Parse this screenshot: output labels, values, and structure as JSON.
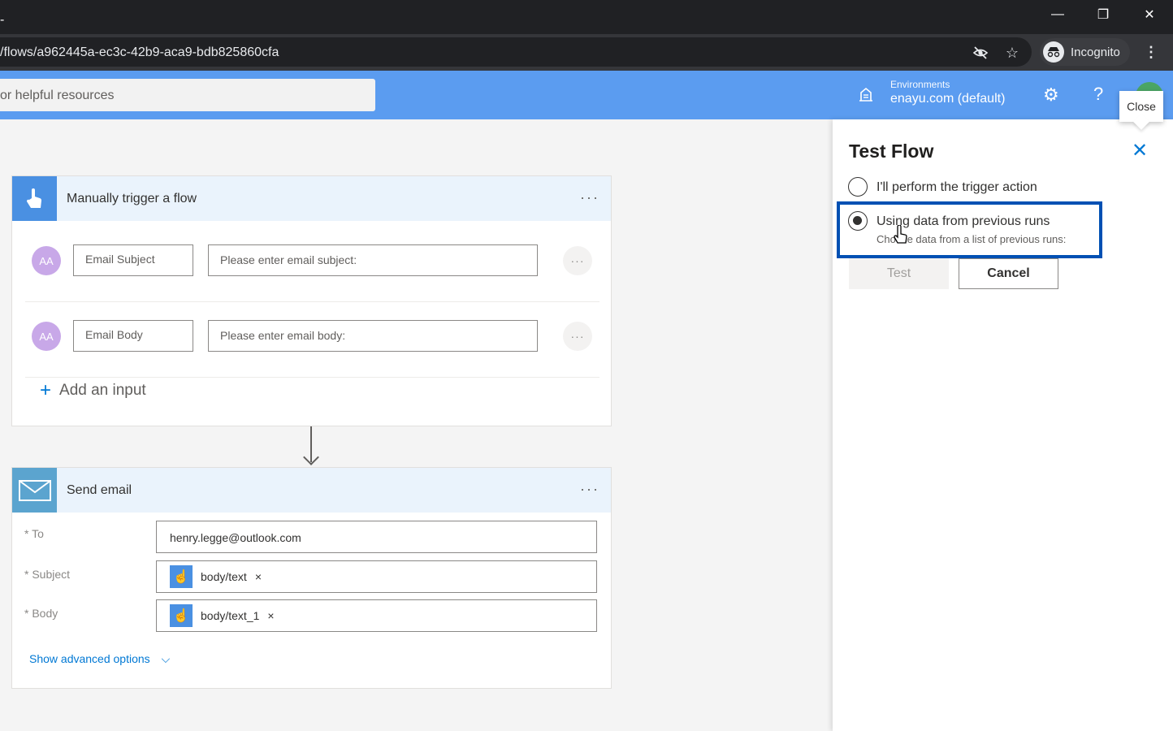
{
  "browser": {
    "url": "/flows/a962445a-ec3c-42b9-aca9-bdb825860cfa",
    "incognito_label": "Incognito",
    "menu_glyph": "⋮"
  },
  "header": {
    "search_placeholder": "or helpful resources",
    "env_label": "Environments",
    "env_value": "enayu.com (default)",
    "help_glyph": "?"
  },
  "tooltip": {
    "text": "Close"
  },
  "trigger_card": {
    "title": "Manually trigger a flow",
    "more": "···",
    "inputs": [
      {
        "avatar": "AA",
        "name": "Email Subject",
        "placeholder": "Please enter email subject:",
        "more": "···"
      },
      {
        "avatar": "AA",
        "name": "Email Body",
        "placeholder": "Please enter email body:",
        "more": "···"
      }
    ],
    "add_input": "Add an input"
  },
  "send_card": {
    "title": "Send email",
    "more": "···",
    "to_label": "* To",
    "to_value": "henry.legge@outlook.com",
    "subject_label": "* Subject",
    "subject_token": "body/text",
    "body_label": "* Body",
    "body_token": "body/text_1",
    "token_remove": "×",
    "show_advanced": "Show advanced options",
    "chevron": "⌵"
  },
  "panel": {
    "title": "Test Flow",
    "close_glyph": "✕",
    "option1": "I'll perform the trigger action",
    "option2": "Using data from previous runs",
    "option2_sub": "Choose data from a list of previous runs:",
    "test_button": "Test",
    "cancel_button": "Cancel"
  },
  "colors": {
    "header_bg": "#5b9cf0",
    "accent": "#0078d4",
    "focus_border": "#0050b3"
  }
}
